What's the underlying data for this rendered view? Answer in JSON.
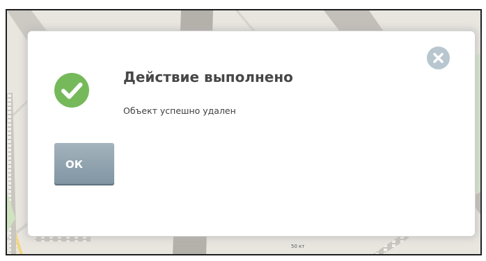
{
  "dialog": {
    "title": "Действие выполнено",
    "message": "Объект успешно удален",
    "ok_label": "ОК",
    "icons": {
      "status": "check-circle-icon",
      "close": "close-icon"
    }
  },
  "map": {
    "scale_label": "50 кт"
  },
  "colors": {
    "success_green": "#76b95b",
    "close_icon_bg": "#b7c6cf",
    "ok_button_top": "#a4b3bd",
    "ok_button_bottom": "#7f94a2",
    "title_text": "#474747",
    "map_background": "#e9e6e0",
    "frame_border": "#1e1e1e"
  }
}
